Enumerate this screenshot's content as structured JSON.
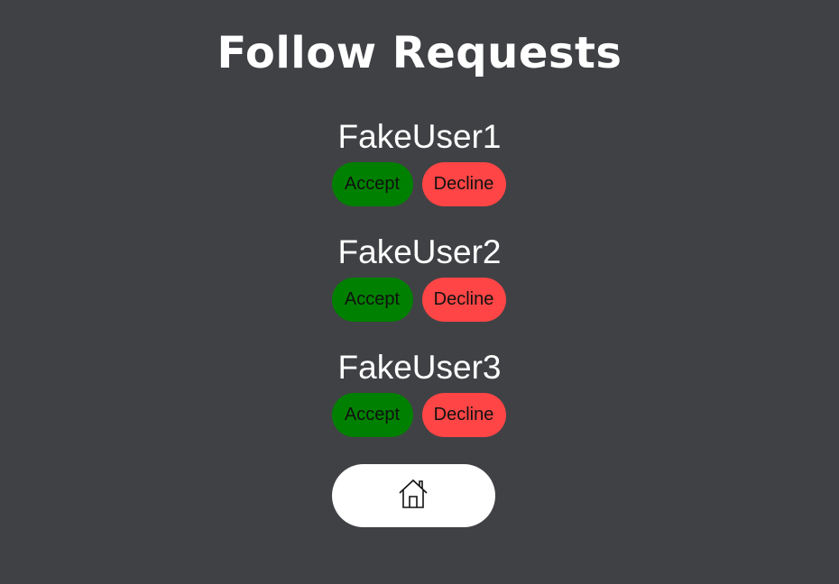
{
  "header": {
    "title": "Follow Requests"
  },
  "requests": [
    {
      "username": "FakeUser1",
      "accept_label": "Accept",
      "decline_label": "Decline"
    },
    {
      "username": "FakeUser2",
      "accept_label": "Accept",
      "decline_label": "Decline"
    },
    {
      "username": "FakeUser3",
      "accept_label": "Accept",
      "decline_label": "Decline"
    }
  ],
  "home_button": {
    "icon": "home-icon"
  },
  "colors": {
    "background": "#404145",
    "accept": "#008000",
    "decline": "#ff4545",
    "home_button": "#ffffff",
    "text": "#ffffff"
  }
}
